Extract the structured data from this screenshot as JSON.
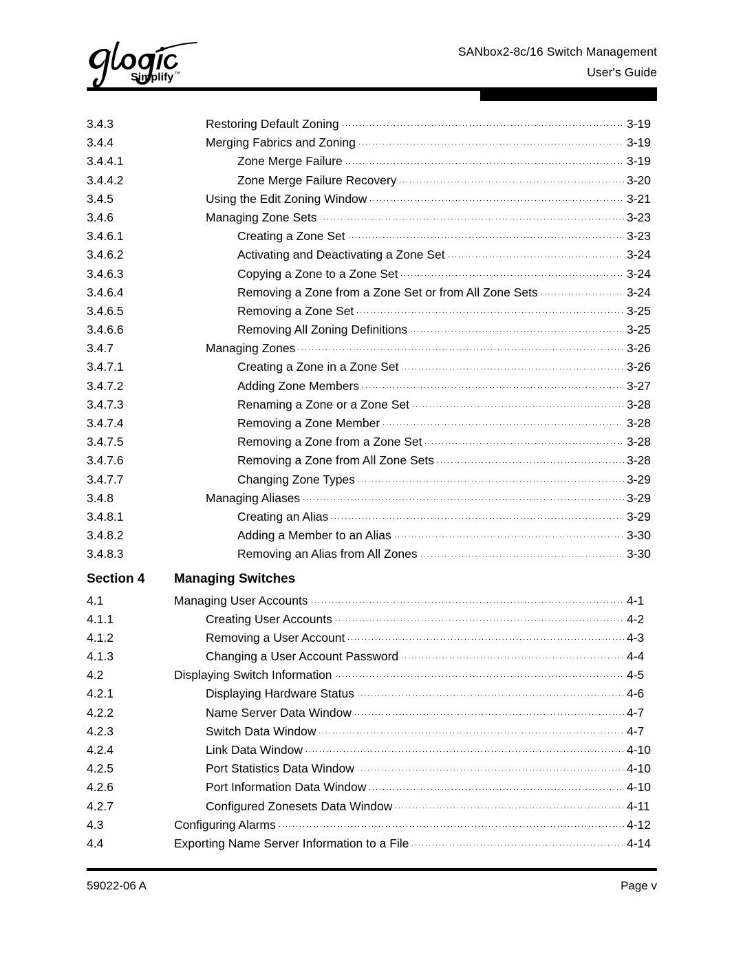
{
  "header": {
    "logo": {
      "wordmark": "QLogic",
      "tagline": "Simplify",
      "trademark": "™"
    },
    "title_line1": "SANbox2-8c/16 Switch Management",
    "title_line2": "User's Guide"
  },
  "toc": {
    "rows": [
      {
        "kind": "entry",
        "level": "a",
        "number": "3.4.3",
        "title": "Restoring Default Zoning",
        "page": "3-19"
      },
      {
        "kind": "entry",
        "level": "a",
        "number": "3.4.4",
        "title": "Merging Fabrics and Zoning",
        "page": "3-19"
      },
      {
        "kind": "entry",
        "level": "b",
        "number": "3.4.4.1",
        "title": "Zone Merge Failure",
        "page": "3-19"
      },
      {
        "kind": "entry",
        "level": "b",
        "number": "3.4.4.2",
        "title": "Zone Merge Failure Recovery",
        "page": "3-20"
      },
      {
        "kind": "entry",
        "level": "a",
        "number": "3.4.5",
        "title": "Using the Edit Zoning Window",
        "page": "3-21"
      },
      {
        "kind": "entry",
        "level": "a",
        "number": "3.4.6",
        "title": "Managing Zone Sets",
        "page": "3-23"
      },
      {
        "kind": "entry",
        "level": "b",
        "number": "3.4.6.1",
        "title": "Creating a Zone Set",
        "page": "3-23"
      },
      {
        "kind": "entry",
        "level": "b",
        "number": "3.4.6.2",
        "title": "Activating and Deactivating a Zone Set",
        "page": "3-24"
      },
      {
        "kind": "entry",
        "level": "b",
        "number": "3.4.6.3",
        "title": "Copying a Zone to a Zone Set",
        "page": "3-24"
      },
      {
        "kind": "entry",
        "level": "b",
        "number": "3.4.6.4",
        "title": "Removing a Zone from a Zone Set or from All Zone Sets",
        "page": "3-24"
      },
      {
        "kind": "entry",
        "level": "b",
        "number": "3.4.6.5",
        "title": "Removing a Zone Set",
        "page": "3-25"
      },
      {
        "kind": "entry",
        "level": "b",
        "number": "3.4.6.6",
        "title": "Removing All Zoning Definitions",
        "page": "3-25"
      },
      {
        "kind": "entry",
        "level": "a",
        "number": "3.4.7",
        "title": "Managing Zones",
        "page": "3-26"
      },
      {
        "kind": "entry",
        "level": "b",
        "number": "3.4.7.1",
        "title": "Creating a Zone in a Zone Set",
        "page": "3-26"
      },
      {
        "kind": "entry",
        "level": "b",
        "number": "3.4.7.2",
        "title": "Adding Zone Members",
        "page": "3-27"
      },
      {
        "kind": "entry",
        "level": "b",
        "number": "3.4.7.3",
        "title": "Renaming a Zone or a Zone Set",
        "page": "3-28"
      },
      {
        "kind": "entry",
        "level": "b",
        "number": "3.4.7.4",
        "title": "Removing a Zone Member",
        "page": "3-28"
      },
      {
        "kind": "entry",
        "level": "b",
        "number": "3.4.7.5",
        "title": "Removing a Zone from a Zone Set",
        "page": "3-28"
      },
      {
        "kind": "entry",
        "level": "b",
        "number": "3.4.7.6",
        "title": "Removing a Zone from All Zone Sets",
        "page": "3-28"
      },
      {
        "kind": "entry",
        "level": "b",
        "number": "3.4.7.7",
        "title": "Changing Zone Types",
        "page": "3-29"
      },
      {
        "kind": "entry",
        "level": "a",
        "number": "3.4.8",
        "title": "Managing Aliases",
        "page": "3-29"
      },
      {
        "kind": "entry",
        "level": "b",
        "number": "3.4.8.1",
        "title": "Creating an Alias",
        "page": "3-29"
      },
      {
        "kind": "entry",
        "level": "b",
        "number": "3.4.8.2",
        "title": "Adding a Member to an Alias",
        "page": "3-30"
      },
      {
        "kind": "entry",
        "level": "b",
        "number": "3.4.8.3",
        "title": "Removing an Alias from All Zones",
        "page": "3-30"
      },
      {
        "kind": "section",
        "label": "Section 4",
        "title": "Managing Switches"
      },
      {
        "kind": "entry",
        "level": "s",
        "number": "4.1",
        "title": "Managing User Accounts",
        "page": "4-1"
      },
      {
        "kind": "entry",
        "level": "a",
        "number": "4.1.1",
        "title": "Creating User Accounts",
        "page": "4-2"
      },
      {
        "kind": "entry",
        "level": "a",
        "number": "4.1.2",
        "title": "Removing a User Account",
        "page": "4-3"
      },
      {
        "kind": "entry",
        "level": "a",
        "number": "4.1.3",
        "title": "Changing a User Account Password",
        "page": "4-4"
      },
      {
        "kind": "entry",
        "level": "s",
        "number": "4.2",
        "title": "Displaying Switch Information",
        "page": "4-5"
      },
      {
        "kind": "entry",
        "level": "a",
        "number": "4.2.1",
        "title": "Displaying Hardware Status",
        "page": "4-6"
      },
      {
        "kind": "entry",
        "level": "a",
        "number": "4.2.2",
        "title": "Name Server Data Window",
        "page": "4-7"
      },
      {
        "kind": "entry",
        "level": "a",
        "number": "4.2.3",
        "title": "Switch Data Window",
        "page": "4-7"
      },
      {
        "kind": "entry",
        "level": "a",
        "number": "4.2.4",
        "title": "Link Data Window",
        "page": "4-10"
      },
      {
        "kind": "entry",
        "level": "a",
        "number": "4.2.5",
        "title": "Port Statistics Data Window",
        "page": "4-10"
      },
      {
        "kind": "entry",
        "level": "a",
        "number": "4.2.6",
        "title": "Port Information Data Window",
        "page": "4-10"
      },
      {
        "kind": "entry",
        "level": "a",
        "number": "4.2.7",
        "title": "Configured Zonesets Data Window",
        "page": "4-11"
      },
      {
        "kind": "entry",
        "level": "s",
        "number": "4.3",
        "title": "Configuring Alarms",
        "page": "4-12"
      },
      {
        "kind": "entry",
        "level": "s",
        "number": "4.4",
        "title": "Exporting Name Server Information to a File",
        "page": "4-14"
      }
    ]
  },
  "footer": {
    "document_number": "59022-06  A",
    "page_label": "Page v"
  },
  "colors": {
    "ink": "#000000",
    "paper": "#ffffff"
  }
}
